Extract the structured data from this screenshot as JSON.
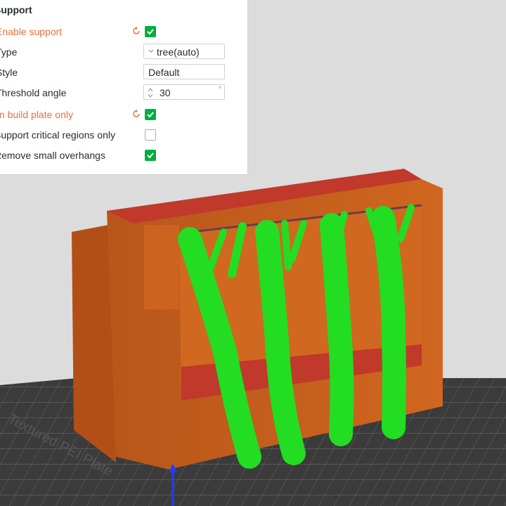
{
  "panel": {
    "section_title": "Support",
    "rows": [
      {
        "label": "Enable support",
        "changed": true,
        "checked": true
      },
      {
        "label": "Type",
        "value": "tree(auto)"
      },
      {
        "label": "Style",
        "value": "Default"
      },
      {
        "label": "Threshold angle",
        "value": "30",
        "unit": "°"
      },
      {
        "label": "On build plate only",
        "changed": true,
        "checked": true
      },
      {
        "label": "Support critical regions only",
        "checked": false
      },
      {
        "label": "Remove small overhangs",
        "checked": true
      }
    ]
  },
  "plate": {
    "label": "Textured PEI Plate"
  },
  "colors": {
    "model": "#c85a1e",
    "model_top": "#c0392b",
    "support": "#22dd22",
    "bed": "#3a3a3a",
    "accent_changed": "#e8703a",
    "check": "#00ae42"
  }
}
